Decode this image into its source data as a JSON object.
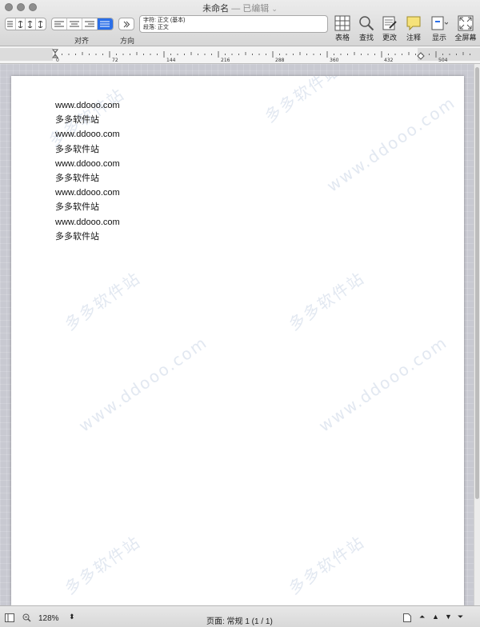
{
  "window": {
    "title": "未命名",
    "edited_label": "— 已编辑"
  },
  "toolbar": {
    "align_label": "对齐",
    "direction_label": "方向",
    "style_box": {
      "char_style": "字符: 正文 (基本)",
      "para_style": "段落: 正文"
    },
    "tools": [
      {
        "label": "表格",
        "icon": "table-icon"
      },
      {
        "label": "查找",
        "icon": "search-icon"
      },
      {
        "label": "更改",
        "icon": "track-changes-icon"
      },
      {
        "label": "注释",
        "icon": "comment-icon"
      },
      {
        "label": "显示",
        "icon": "view-icon"
      },
      {
        "label": "全屏幕",
        "icon": "fullscreen-icon"
      }
    ]
  },
  "ruler": {
    "ticks": [
      "0",
      "72",
      "144",
      "216",
      "288",
      "360",
      "432",
      "504"
    ]
  },
  "document": {
    "lines": [
      "www.ddooo.com",
      "多多软件站",
      "www.ddooo.com",
      "多多软件站",
      "www.ddooo.com",
      "多多软件站",
      "www.ddooo.com",
      "多多软件站",
      "www.ddooo.com",
      "多多软件站"
    ],
    "watermark_cn": "多多软件站",
    "watermark_en": "www.ddooo.com"
  },
  "statusbar": {
    "zoom": "128%",
    "page_info": "页面: 常规 1 (1 / 1)"
  },
  "colors": {
    "accent": "#2b6fe8",
    "comment_yellow": "#f6e27a"
  }
}
